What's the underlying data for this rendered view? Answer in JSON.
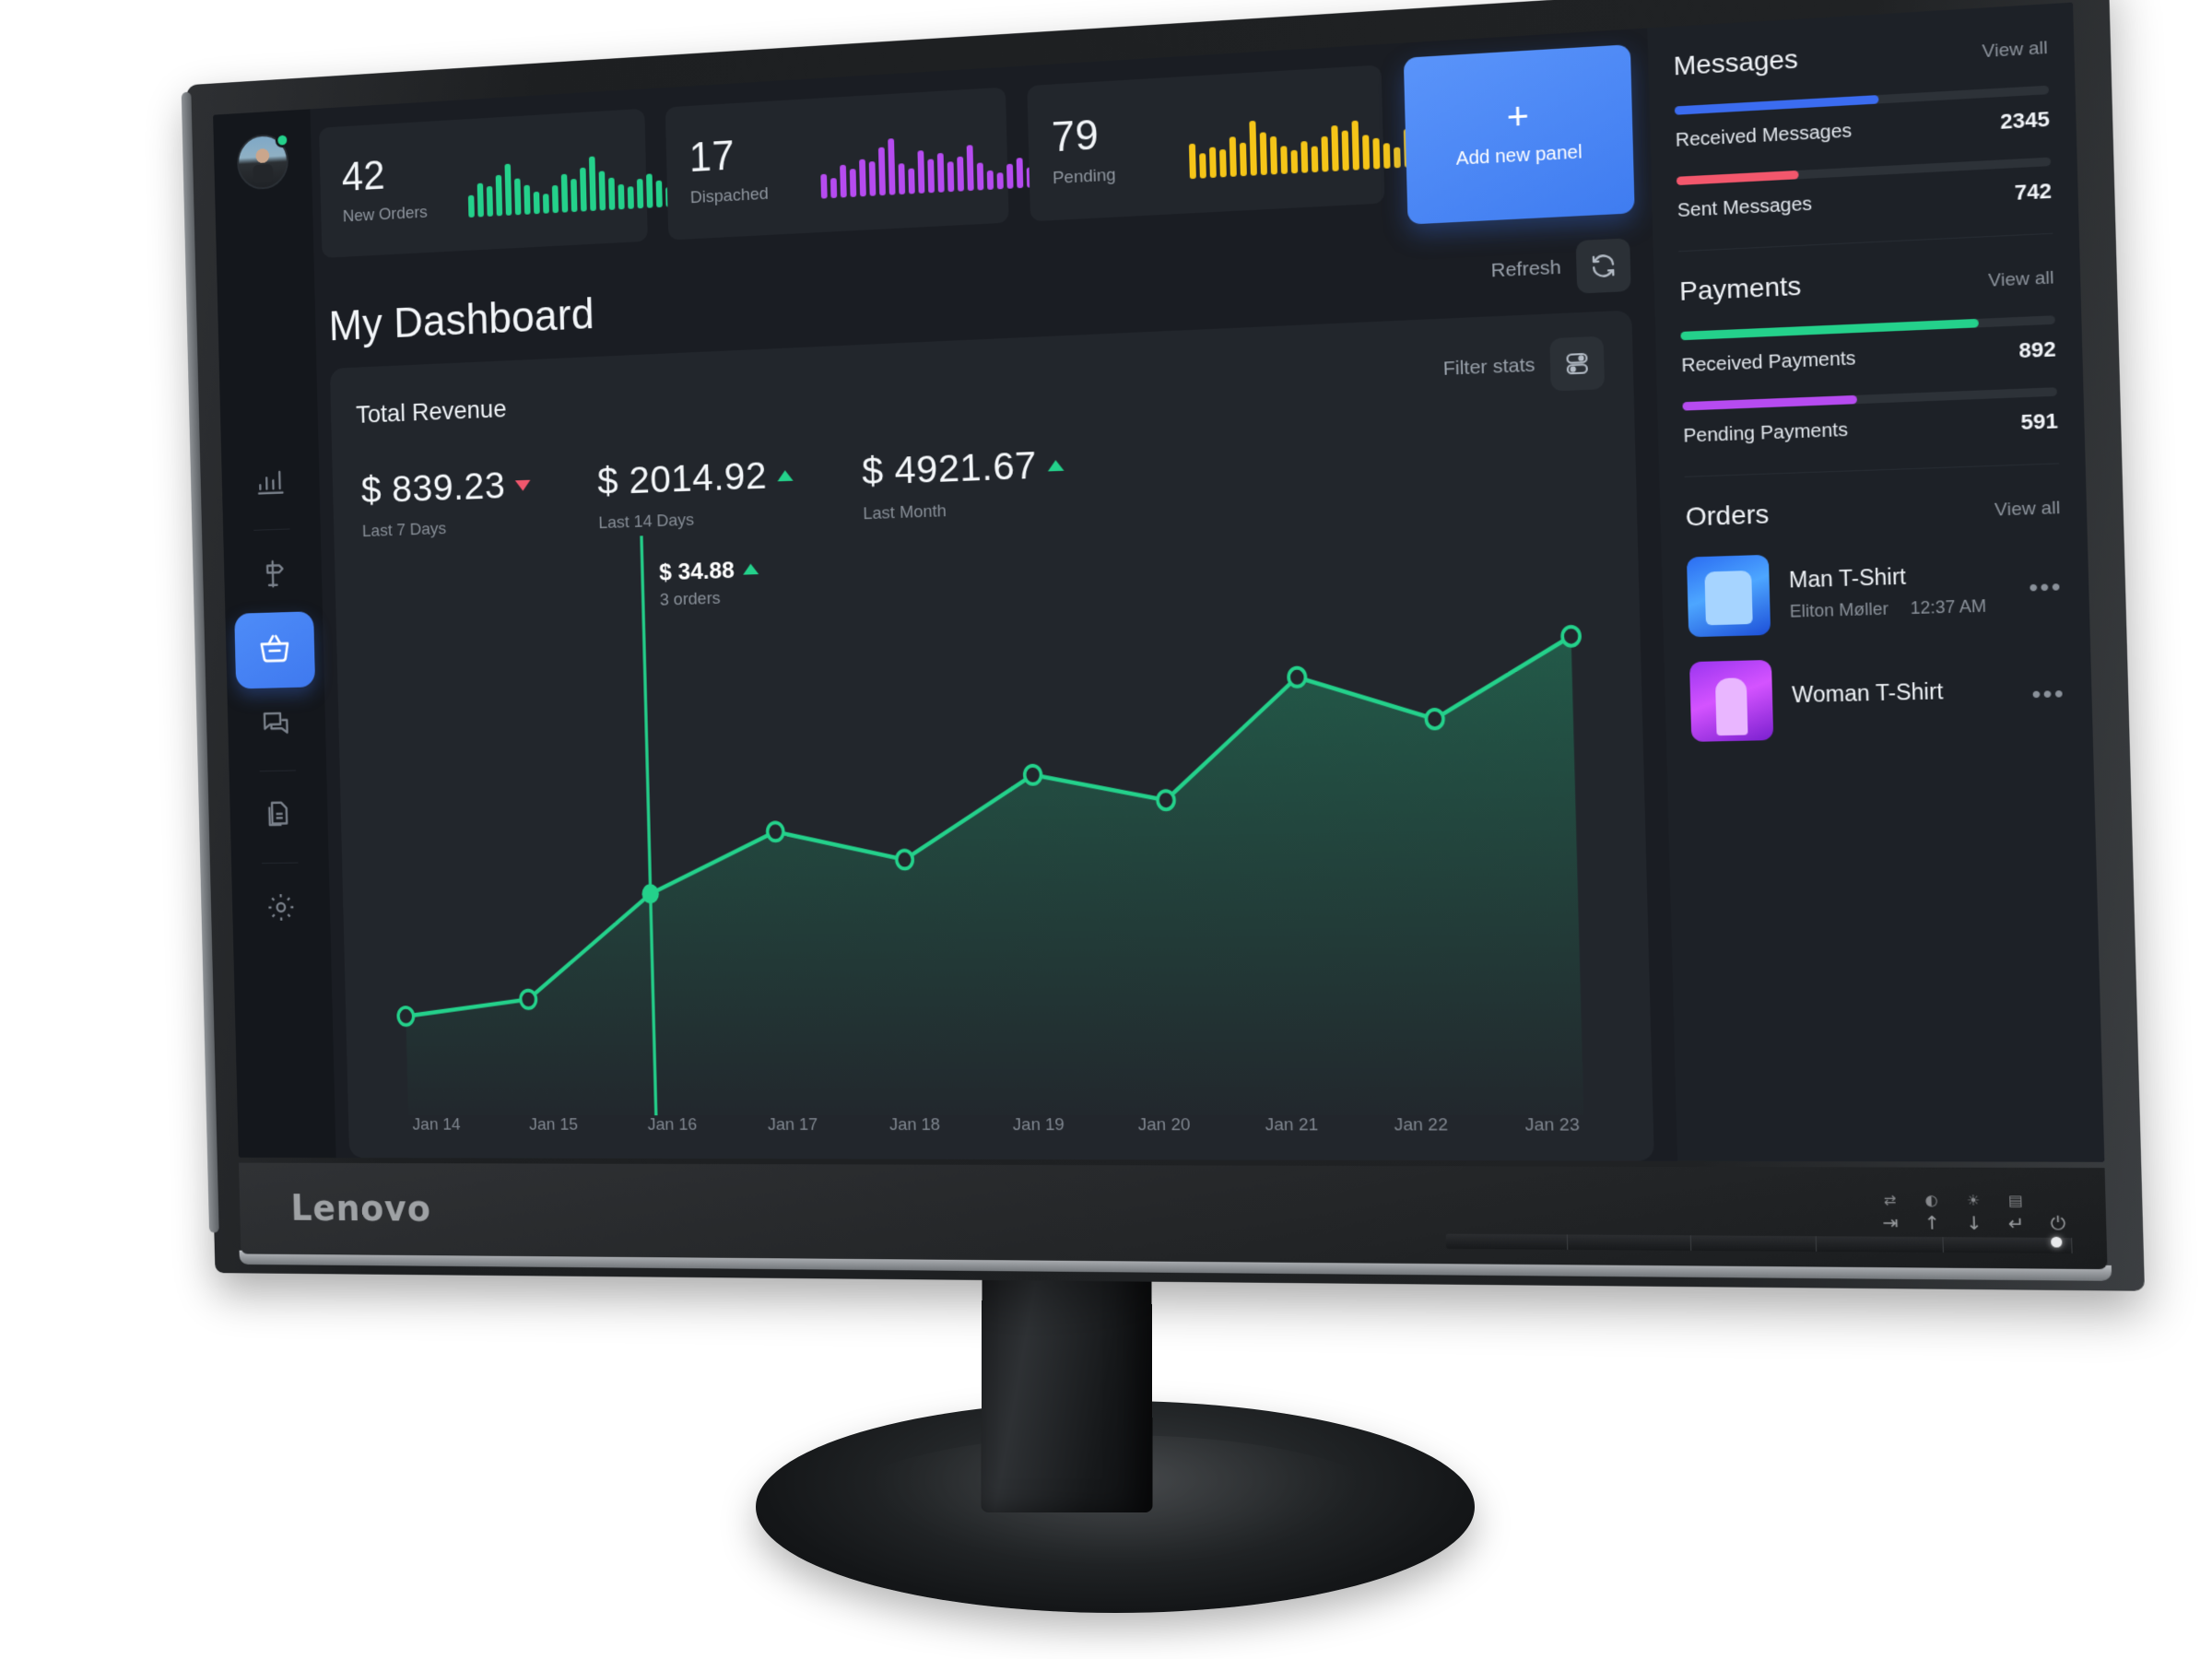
{
  "device": {
    "brand": "Lenovo"
  },
  "sidebar": {
    "items": [
      {
        "name": "analytics",
        "icon": "bar-chart-icon",
        "active": false
      },
      {
        "name": "campaigns",
        "icon": "signpost-icon",
        "active": false
      },
      {
        "name": "orders",
        "icon": "basket-icon",
        "active": true
      },
      {
        "name": "messages",
        "icon": "chat-icon",
        "active": false
      },
      {
        "name": "documents",
        "icon": "documents-icon",
        "active": false
      },
      {
        "name": "settings",
        "icon": "gear-icon",
        "active": false
      }
    ]
  },
  "stats": [
    {
      "value": "42",
      "label": "New Orders",
      "color": "#24d18b"
    },
    {
      "value": "17",
      "label": "Dispached",
      "color": "#b64bf0"
    },
    {
      "value": "79",
      "label": "Pending",
      "color": "#f5c518"
    }
  ],
  "add_panel": {
    "plus": "+",
    "label": "Add new panel"
  },
  "header": {
    "title": "My Dashboard",
    "refresh_label": "Refresh",
    "refresh_icon": "refresh-icon"
  },
  "revenue": {
    "title": "Total Revenue",
    "filter_label": "Filter stats",
    "filter_icon": "toggles-icon",
    "kpis": [
      {
        "value": "$ 839.23",
        "period": "Last 7 Days",
        "trend": "down"
      },
      {
        "value": "$ 2014.92",
        "period": "Last 14 Days",
        "trend": "up"
      },
      {
        "value": "$ 4921.67",
        "period": "Last Month",
        "trend": "up"
      }
    ],
    "tooltip": {
      "value": "$ 34.88",
      "sub": "3 orders",
      "trend": "up"
    }
  },
  "chart_data": {
    "type": "line",
    "title": "Total Revenue",
    "xlabel": "",
    "ylabel": "",
    "categories": [
      "Jan 14",
      "Jan 15",
      "Jan 16",
      "Jan 17",
      "Jan 18",
      "Jan 19",
      "Jan 20",
      "Jan 21",
      "Jan 22",
      "Jan 23"
    ],
    "values": [
      12.5,
      15.5,
      34.88,
      46.0,
      40.5,
      55.5,
      50.5,
      72.0,
      64.0,
      78.0
    ],
    "series": [
      {
        "name": "Revenue",
        "values": [
          12.5,
          15.5,
          34.88,
          46.0,
          40.5,
          55.5,
          50.5,
          72.0,
          64.0,
          78.0
        ]
      }
    ],
    "ylim": [
      0,
      92
    ],
    "grid": false,
    "legend": "none",
    "line_color": "#24d18b",
    "area_fill": true,
    "highlight_index": 2,
    "annotations": [
      {
        "index": 2,
        "label": "$ 34.88",
        "sub": "3 orders"
      }
    ]
  },
  "messages": {
    "title": "Messages",
    "view_all": "View all",
    "rows": [
      {
        "name": "Received Messages",
        "value": "2345",
        "pct": 55,
        "color": "#3b6cf0"
      },
      {
        "name": "Sent Messages",
        "value": "742",
        "pct": 33,
        "color": "#f3576c"
      }
    ]
  },
  "payments": {
    "title": "Payments",
    "view_all": "View all",
    "rows": [
      {
        "name": "Received Payments",
        "value": "892",
        "pct": 80,
        "color": "#24d18b"
      },
      {
        "name": "Pending Payments",
        "value": "591",
        "pct": 47,
        "color": "#b64bf0"
      }
    ]
  },
  "orders": {
    "title": "Orders",
    "view_all": "View all",
    "items": [
      {
        "title": "Man T-Shirt",
        "customer": "Eliton Møller",
        "time": "12:37 AM",
        "thumb": "blue",
        "menu": "•••"
      },
      {
        "title": "Woman T-Shirt",
        "customer": "",
        "time": "",
        "thumb": "purple",
        "menu": "•••"
      }
    ]
  }
}
